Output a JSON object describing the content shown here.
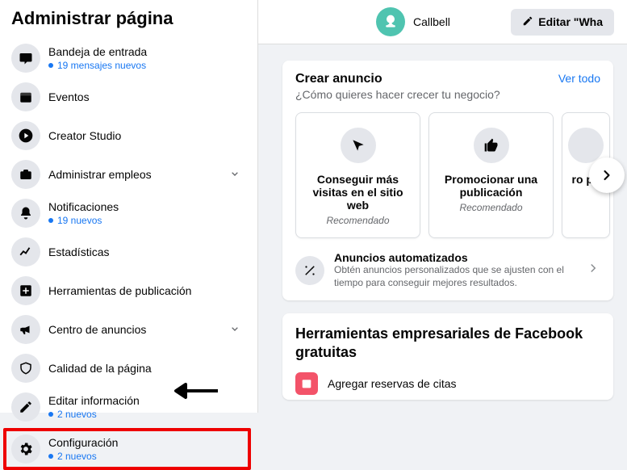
{
  "sidebar": {
    "title": "Administrar página",
    "items": [
      {
        "label": "Bandeja de entrada",
        "sub": "19 mensajes nuevos",
        "expandable": false
      },
      {
        "label": "Eventos",
        "sub": null,
        "expandable": false
      },
      {
        "label": "Creator Studio",
        "sub": null,
        "expandable": false
      },
      {
        "label": "Administrar empleos",
        "sub": null,
        "expandable": true
      },
      {
        "label": "Notificaciones",
        "sub": "19 nuevos",
        "expandable": false
      },
      {
        "label": "Estadísticas",
        "sub": null,
        "expandable": false
      },
      {
        "label": "Herramientas de publicación",
        "sub": null,
        "expandable": false
      },
      {
        "label": "Centro de anuncios",
        "sub": null,
        "expandable": true
      },
      {
        "label": "Calidad de la página",
        "sub": null,
        "expandable": false
      },
      {
        "label": "Editar información",
        "sub": "2 nuevos",
        "expandable": false
      },
      {
        "label": "Configuración",
        "sub": "2 nuevos",
        "expandable": false
      }
    ]
  },
  "header": {
    "page_name": "Callbell",
    "edit_button": "Editar \"Wha"
  },
  "create_ad": {
    "title": "Crear anuncio",
    "see_all": "Ver todo",
    "subtitle": "¿Cómo quieres hacer crecer tu negocio?",
    "options": [
      {
        "title": "Conseguir más visitas en el sitio web",
        "sub": "Recomendado"
      },
      {
        "title": "Promocionar una publicación",
        "sub": "Recomendado"
      },
      {
        "title": "ro pu",
        "sub": ""
      }
    ],
    "auto": {
      "title": "Anuncios automatizados",
      "description": "Obtén anuncios personalizados que se ajusten con el tiempo para conseguir mejores resultados."
    }
  },
  "tools": {
    "title": "Herramientas empresariales de Facebook gratuitas",
    "items": [
      {
        "label": "Agregar reservas de citas"
      }
    ]
  }
}
